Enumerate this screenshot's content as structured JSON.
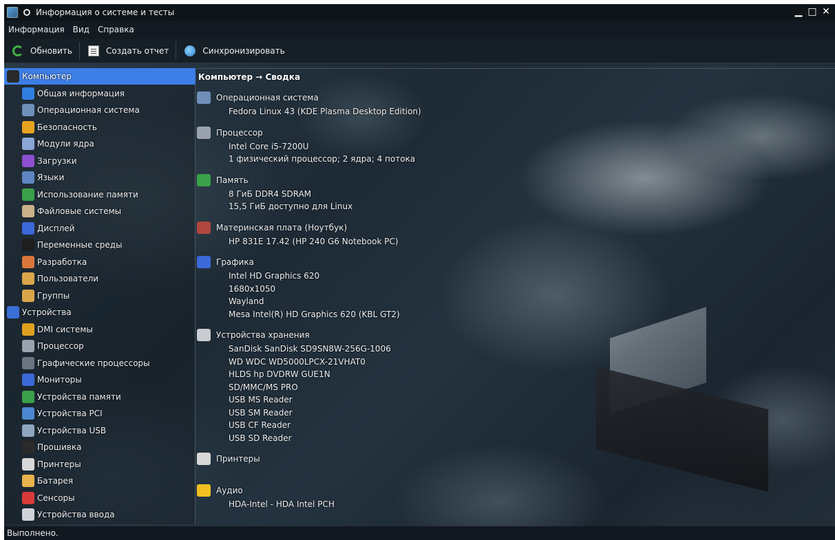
{
  "window": {
    "title": "Информация о системе и тесты",
    "controls": {
      "minimize": "▁",
      "maximize": "□",
      "close": "✕"
    }
  },
  "menubar": {
    "items": [
      "Информация",
      "Вид",
      "Справка"
    ]
  },
  "toolbar": {
    "refresh_label": "Обновить",
    "report_label": "Создать отчет",
    "sync_label": "Синхронизировать"
  },
  "sidebar": {
    "items": [
      {
        "label": "Компьютер",
        "level": 0,
        "selected": true,
        "icon": "computer-icon",
        "color": "#2a2a2a"
      },
      {
        "label": "Общая информация",
        "level": 1,
        "icon": "info-icon",
        "color": "#2f7fe0"
      },
      {
        "label": "Операционная система",
        "level": 1,
        "icon": "os-gear-icon",
        "color": "#6f8fb8"
      },
      {
        "label": "Безопасность",
        "level": 1,
        "icon": "shield-icon",
        "color": "#e6a31e"
      },
      {
        "label": "Модули ядра",
        "level": 1,
        "icon": "kernel-module-icon",
        "color": "#8aa6d6"
      },
      {
        "label": "Загрузки",
        "level": 1,
        "icon": "rocket-icon",
        "color": "#8c4fcf"
      },
      {
        "label": "Языки",
        "level": 1,
        "icon": "language-icon",
        "color": "#5f86c2"
      },
      {
        "label": "Использование памяти",
        "level": 1,
        "icon": "memory-icon",
        "color": "#3aa04a"
      },
      {
        "label": "Файловые системы",
        "level": 1,
        "icon": "filesystem-icon",
        "color": "#c9b18a"
      },
      {
        "label": "Дисплей",
        "level": 1,
        "icon": "display-icon",
        "color": "#3c68d8"
      },
      {
        "label": "Переменные среды",
        "level": 1,
        "icon": "terminal-icon",
        "color": "#1e1e1e"
      },
      {
        "label": "Разработка",
        "level": 1,
        "icon": "development-icon",
        "color": "#d9773b"
      },
      {
        "label": "Пользователи",
        "level": 1,
        "icon": "users-icon",
        "color": "#d9a64a"
      },
      {
        "label": "Группы",
        "level": 1,
        "icon": "groups-icon",
        "color": "#d9a64a"
      },
      {
        "label": "Устройства",
        "level": 0,
        "icon": "devices-icon",
        "color": "#3b6fd8"
      },
      {
        "label": "DMI системы",
        "level": 1,
        "icon": "dmi-icon",
        "color": "#e0a020"
      },
      {
        "label": "Процессор",
        "level": 1,
        "icon": "cpu-icon",
        "color": "#9aa3ad"
      },
      {
        "label": "Графические процессоры",
        "level": 1,
        "icon": "gpu-icon",
        "color": "#6b7480"
      },
      {
        "label": "Мониторы",
        "level": 1,
        "icon": "monitor-icon",
        "color": "#3c68d8"
      },
      {
        "label": "Устройства памяти",
        "level": 1,
        "icon": "memory-module-icon",
        "color": "#3aa04a"
      },
      {
        "label": "Устройства PCI",
        "level": 1,
        "icon": "pci-icon",
        "color": "#4c86d0"
      },
      {
        "label": "Устройства USB",
        "level": 1,
        "icon": "usb-icon",
        "color": "#8fa6c0"
      },
      {
        "label": "Прошивка",
        "level": 1,
        "icon": "firmware-icon",
        "color": "#2a2a2a"
      },
      {
        "label": "Принтеры",
        "level": 1,
        "icon": "printer-icon",
        "color": "#d8d8d8"
      },
      {
        "label": "Батарея",
        "level": 1,
        "icon": "battery-icon",
        "color": "#e8b24a"
      },
      {
        "label": "Сенсоры",
        "level": 1,
        "icon": "thermometer-icon",
        "color": "#d83a3a"
      },
      {
        "label": "Устройства ввода",
        "level": 1,
        "icon": "input-devices-icon",
        "color": "#cfd3d8"
      }
    ]
  },
  "content": {
    "title": "Компьютер → Сводка",
    "sections": [
      {
        "label": "Операционная система",
        "icon": "os-gear-icon",
        "color": "#6f8fb8",
        "values": [
          "Fedora Linux 43 (KDE Plasma Desktop Edition)"
        ]
      },
      {
        "label": "Процессор",
        "icon": "cpu-icon",
        "color": "#9aa3ad",
        "values": [
          "Intel Core i5-7200U",
          "1 физический процессор; 2 ядра; 4 потока"
        ]
      },
      {
        "label": "Память",
        "icon": "memory-icon",
        "color": "#3aa04a",
        "values": [
          "8 ГиБ DDR4 SDRAM",
          "15,5 ГиБ доступно для Linux"
        ]
      },
      {
        "label": "Материнская плата (Ноутбук)",
        "icon": "motherboard-icon",
        "color": "#b0473f",
        "values": [
          "HP 831E 17.42 (HP 240 G6 Notebook PC)"
        ]
      },
      {
        "label": "Графика",
        "icon": "display-icon",
        "color": "#3c68d8",
        "values": [
          "Intel HD Graphics 620",
          "1680x1050",
          "Wayland",
          "Mesa Intel(R) HD Graphics 620 (KBL GT2)"
        ]
      },
      {
        "label": "Устройства хранения",
        "icon": "storage-icon",
        "color": "#c9ccd0",
        "values": [
          "SanDisk SanDisk SD9SN8W-256G-1006",
          "WD WDC WD5000LPCX-21VHAT0",
          "HLDS hp   DVDRW GUE1N",
          "SD/MMC/MS PRO",
          "USB MS Reader",
          "USB SM Reader",
          "USB CF Reader",
          "USB SD Reader"
        ]
      },
      {
        "label": "Принтеры",
        "icon": "printer-icon",
        "color": "#d8d8d8",
        "values": []
      },
      {
        "label": "Аудио",
        "icon": "audio-icon",
        "color": "#f0c020",
        "values": [
          "HDA-Intel - HDA Intel PCH"
        ]
      }
    ]
  },
  "statusbar": {
    "text": "Выполнено."
  }
}
